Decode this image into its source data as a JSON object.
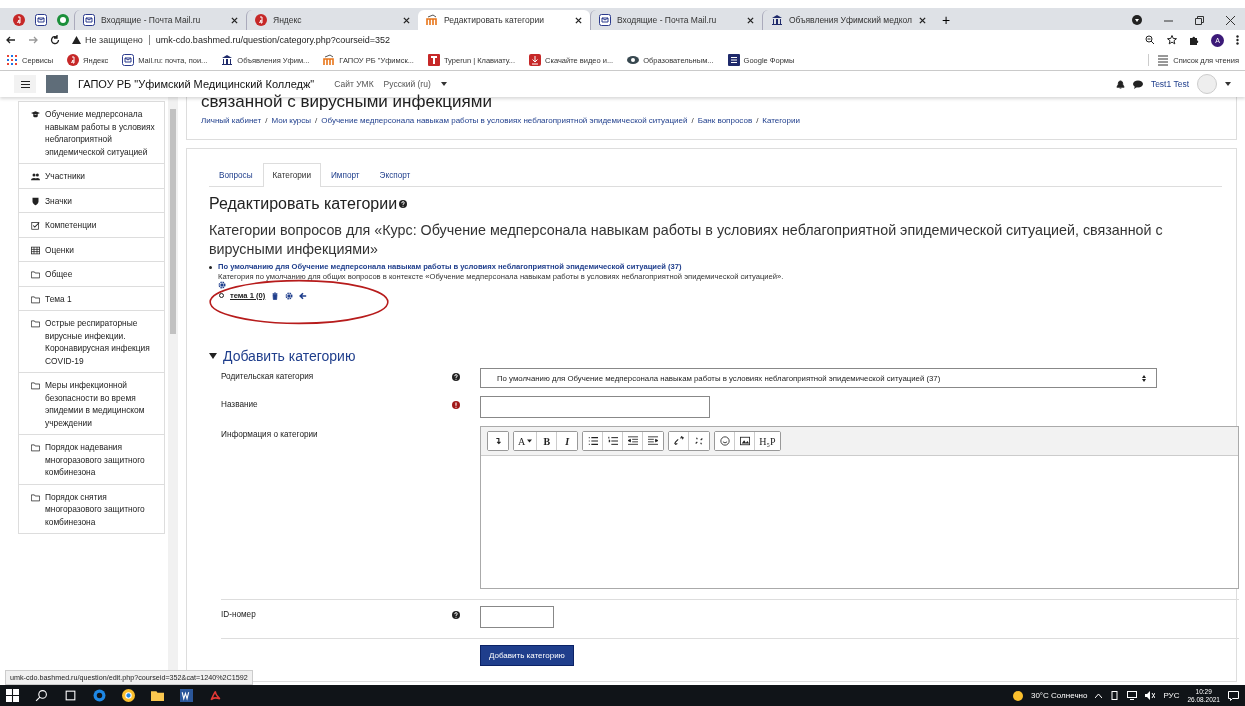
{
  "browser": {
    "pinned_tabs": [
      {
        "kind": "yandex"
      },
      {
        "kind": "mail"
      },
      {
        "kind": "chat"
      }
    ],
    "tabs": [
      {
        "title": "Входящие - Почта Mail.ru",
        "kind": "mail",
        "selected": false
      },
      {
        "title": "Яндекс",
        "kind": "yandex",
        "selected": false
      },
      {
        "title": "Редактировать категории",
        "kind": "moodle",
        "selected": true
      },
      {
        "title": "Входящие - Почта Mail.ru",
        "kind": "mail",
        "selected": false
      },
      {
        "title": "Объявления Уфимский медкол",
        "kind": "bank",
        "selected": false
      }
    ],
    "new_tab": "+",
    "security": "Не защищено",
    "url": "umk-cdo.bashmed.ru/question/category.php?courseid=352",
    "bookmarks": [
      {
        "label": "Сервисы",
        "kind": "apps"
      },
      {
        "label": "Яндекс",
        "kind": "yandex"
      },
      {
        "label": "Mail.ru: почта, пои...",
        "kind": "mail"
      },
      {
        "label": "Объявления Уфим...",
        "kind": "bank"
      },
      {
        "label": "ГАПОУ РБ \"Уфимск...",
        "kind": "moodle"
      },
      {
        "label": "Typerun | Клавиату...",
        "kind": "letter"
      },
      {
        "label": "Скачайте видео и...",
        "kind": "download"
      },
      {
        "label": "Образовательным...",
        "kind": "edu"
      },
      {
        "label": "Google Формы",
        "kind": "forms"
      }
    ],
    "reading_list": "Список для чтения",
    "profile_initial": "A"
  },
  "navbar": {
    "site_name": "ГАПОУ РБ \"Уфимский Медицинский Колледж\"",
    "links": [
      "Сайт УМК",
      "Русский (ru)"
    ],
    "user": "Test1 Test"
  },
  "sidebar": {
    "items": [
      {
        "label": "Обучение медперсонала навыкам работы в условиях неблагоприятной эпидемической ситуацией",
        "kind": "course"
      },
      {
        "label": "Участники",
        "kind": "users"
      },
      {
        "label": "Значки",
        "kind": "badges"
      },
      {
        "label": "Компетенции",
        "kind": "competencies"
      },
      {
        "label": "Оценки",
        "kind": "grades"
      },
      {
        "label": "Общее",
        "kind": "folder"
      },
      {
        "label": "Тема 1",
        "kind": "folder"
      },
      {
        "label": "Острые респираторные вирусные инфекции. Коронавирусная инфекция COVID-19",
        "kind": "folder"
      },
      {
        "label": "Меры инфекционной безопасности во время эпидемии в медицинском учреждении",
        "kind": "folder"
      },
      {
        "label": "Порядок надевания многоразового защитного комбинезона",
        "kind": "folder"
      },
      {
        "label": "Порядок снятия многоразового защитного комбинезона",
        "kind": "folder"
      }
    ]
  },
  "page_header": {
    "title": "связанной с вирусными инфекциями",
    "breadcrumbs": [
      "Личный кабинет",
      "Мои курсы",
      "Обучение медперсонала навыкам работы в условиях неблагоприятной эпидемической ситуацией",
      "Банк вопросов",
      "Категории"
    ],
    "separator": "/"
  },
  "tabs": [
    {
      "label": "Вопросы",
      "selected": false
    },
    {
      "label": "Категории",
      "selected": true
    },
    {
      "label": "Импорт",
      "selected": false
    },
    {
      "label": "Экспорт",
      "selected": false
    }
  ],
  "title": "Редактировать категории",
  "heading": "Категории вопросов для «Курс: Обучение медперсонала навыкам работы в условиях неблагоприятной эпидемической ситуацией, связанной с вирусными инфекциями»",
  "categories": [
    {
      "name": "По умолчанию для Обучение медперсонала навыкам работы в условиях неблагоприятной эпидемической ситуацией (37)",
      "description": "Категория по умолчанию для общих вопросов в контексте «Обучение медперсонала навыкам работы в условиях неблагоприятной эпидемической ситуацией».",
      "children": [
        {
          "name": "тема 1 (0)"
        }
      ]
    }
  ],
  "add_section": {
    "title": "Добавить категорию",
    "expanded": true,
    "fields": [
      {
        "label": "Родительская категория",
        "kind": "select",
        "help": true,
        "required": false,
        "value": "По умолчанию для Обучение медперсонала навыкам работы в условиях неблагоприятной эпидемической ситуацией (37)"
      },
      {
        "label": "Название",
        "kind": "text",
        "help": false,
        "required": true
      },
      {
        "label": "Информация о категории",
        "kind": "editor",
        "help": false,
        "required": false
      },
      {
        "label": "ID-номер",
        "kind": "short",
        "help": true,
        "required": false
      }
    ],
    "toolbar": [
      [
        {
          "kind": "collapse"
        }
      ],
      [
        {
          "kind": "text",
          "label": "A",
          "caret": true
        },
        {
          "kind": "bold",
          "label": "B"
        },
        {
          "kind": "italic",
          "label": "I"
        }
      ],
      [
        {
          "kind": "bullets"
        },
        {
          "kind": "numbers"
        },
        {
          "kind": "outdent"
        },
        {
          "kind": "indent"
        }
      ],
      [
        {
          "kind": "link"
        },
        {
          "kind": "unlink"
        }
      ],
      [
        {
          "kind": "emoji"
        },
        {
          "kind": "image"
        },
        {
          "kind": "text",
          "label": "H₅P"
        }
      ]
    ],
    "submit": "Добавить категорию"
  },
  "status_url": "umk-cdo.bashmed.ru/question/edit.php?courseid=352&cat=1240%2C1592",
  "taskbar": {
    "weather": "30°C Солнечно",
    "language": "РУС",
    "time": "10:29",
    "date": "26.08.2021"
  }
}
